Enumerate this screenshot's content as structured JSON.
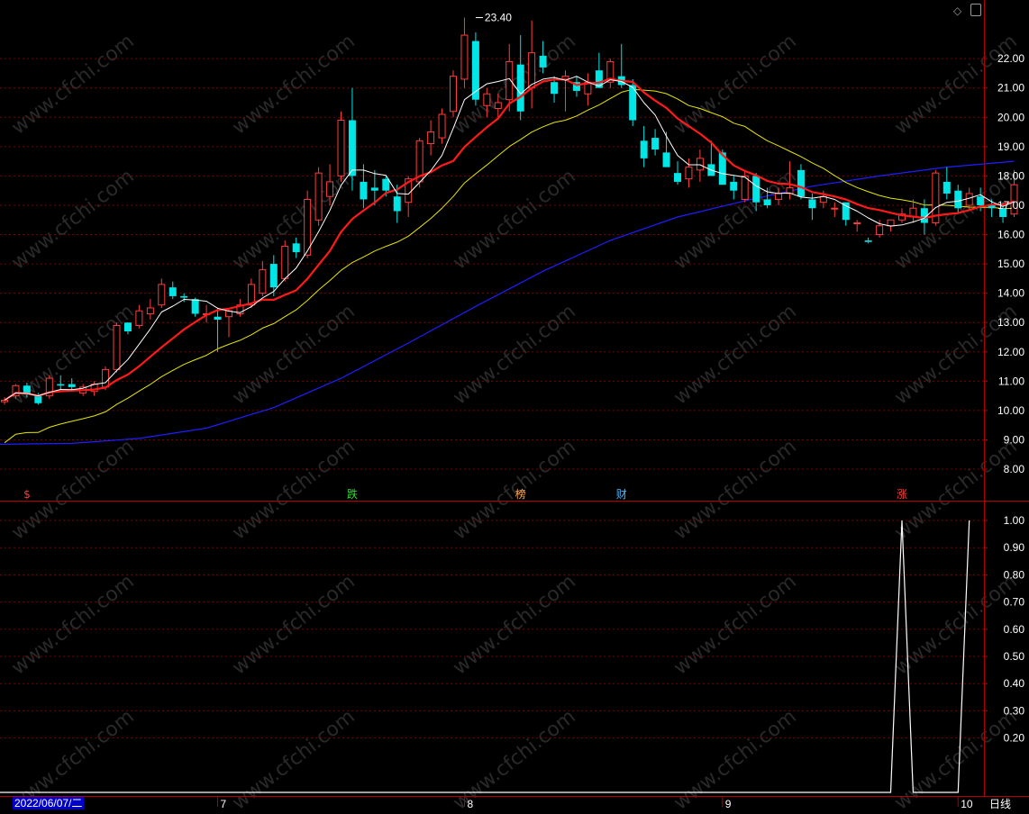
{
  "controls": {
    "diamond_icon": "diamond-icon",
    "window_icon": "window-icon"
  },
  "period_label": "日线",
  "date_cursor": "2022/06/07/二",
  "watermark": "www.cfchi.com",
  "colors": {
    "up": "#ff3c3c",
    "down": "#00e5e5",
    "ma5": "#ffffff",
    "ma10": "#ff1a1a",
    "ma20": "#e6e600",
    "ma60": "#1e1eff",
    "grid": "#7a0000",
    "border": "#b00000"
  },
  "chart_data": [
    {
      "type": "candlestick",
      "title": "",
      "y_ticks": [
        "8.00",
        "9.00",
        "10.00",
        "11.00",
        "12.00",
        "13.00",
        "14.00",
        "15.00",
        "16.00",
        "17.00",
        "18.00",
        "19.00",
        "20.00",
        "21.00",
        "22.00"
      ],
      "ylim": [
        7.05,
        24.0
      ],
      "x_labels": [
        {
          "index": 19,
          "label": "7"
        },
        {
          "index": 41,
          "label": "8"
        },
        {
          "index": 64,
          "label": "9"
        },
        {
          "index": 85,
          "label": "10"
        }
      ],
      "max_annotation": {
        "index": 42,
        "value": 23.4,
        "label": "23.40"
      },
      "event_markers": [
        {
          "index": 2,
          "label": "$",
          "color": "#ff3c3c"
        },
        {
          "index": 31,
          "label": "跌",
          "color": "#35d635"
        },
        {
          "index": 46,
          "label": "榜",
          "color": "#ffa84d"
        },
        {
          "index": 55,
          "label": "财",
          "color": "#4db8ff"
        },
        {
          "index": 80,
          "label": "涨",
          "color": "#ff3c3c"
        }
      ],
      "candles": [
        [
          10.3,
          10.45,
          10.2,
          10.35
        ],
        [
          10.5,
          10.9,
          10.4,
          10.85
        ],
        [
          10.85,
          10.95,
          10.45,
          10.55
        ],
        [
          10.5,
          10.6,
          10.2,
          10.25
        ],
        [
          10.5,
          11.2,
          10.4,
          11.1
        ],
        [
          10.9,
          11.2,
          10.7,
          10.85
        ],
        [
          10.9,
          11.1,
          10.7,
          10.8
        ],
        [
          10.6,
          10.9,
          10.5,
          10.8
        ],
        [
          10.65,
          11.0,
          10.5,
          10.9
        ],
        [
          10.8,
          11.5,
          10.7,
          11.4
        ],
        [
          11.4,
          13.0,
          11.3,
          12.9
        ],
        [
          13.0,
          13.0,
          12.6,
          12.7
        ],
        [
          12.9,
          13.6,
          12.8,
          13.4
        ],
        [
          13.3,
          13.8,
          13.1,
          13.5
        ],
        [
          13.6,
          14.5,
          13.5,
          14.3
        ],
        [
          14.2,
          14.4,
          13.8,
          13.9
        ],
        [
          13.9,
          14.0,
          13.7,
          13.85
        ],
        [
          13.8,
          13.85,
          13.2,
          13.3
        ],
        [
          13.3,
          13.6,
          13.0,
          13.3
        ],
        [
          13.2,
          13.5,
          12.0,
          13.1
        ],
        [
          13.2,
          13.5,
          12.5,
          13.4
        ],
        [
          13.3,
          13.8,
          13.2,
          13.6
        ],
        [
          13.6,
          14.5,
          13.5,
          14.3
        ],
        [
          14.0,
          15.1,
          13.9,
          14.8
        ],
        [
          15.0,
          15.3,
          13.9,
          14.2
        ],
        [
          14.5,
          15.8,
          14.4,
          15.6
        ],
        [
          15.7,
          15.9,
          15.2,
          15.4
        ],
        [
          15.3,
          17.5,
          15.2,
          17.2
        ],
        [
          16.5,
          18.3,
          16.3,
          18.1
        ],
        [
          17.3,
          18.4,
          17.0,
          17.8
        ],
        [
          18.0,
          20.2,
          17.8,
          19.9
        ],
        [
          19.9,
          21.0,
          17.5,
          18.0
        ],
        [
          17.8,
          18.4,
          16.9,
          17.2
        ],
        [
          17.6,
          18.2,
          17.0,
          17.5
        ],
        [
          17.9,
          18.0,
          17.3,
          17.5
        ],
        [
          17.3,
          17.7,
          16.4,
          16.8
        ],
        [
          17.1,
          18.0,
          16.6,
          17.9
        ],
        [
          17.8,
          19.3,
          17.6,
          19.2
        ],
        [
          19.1,
          19.9,
          18.7,
          19.5
        ],
        [
          19.3,
          20.3,
          19.1,
          20.1
        ],
        [
          20.2,
          21.6,
          20.0,
          21.4
        ],
        [
          21.3,
          23.4,
          21.0,
          22.8
        ],
        [
          22.6,
          22.9,
          20.4,
          20.6
        ],
        [
          20.4,
          21.0,
          20.0,
          20.8
        ],
        [
          20.3,
          20.8,
          20.0,
          20.5
        ],
        [
          20.6,
          22.5,
          20.2,
          21.9
        ],
        [
          21.8,
          22.8,
          19.9,
          20.2
        ],
        [
          21.0,
          23.3,
          20.3,
          22.2
        ],
        [
          22.1,
          22.6,
          21.5,
          21.7
        ],
        [
          21.2,
          21.4,
          20.5,
          20.8
        ],
        [
          21.3,
          21.6,
          20.2,
          21.4
        ],
        [
          21.2,
          21.4,
          20.7,
          20.9
        ],
        [
          20.8,
          21.5,
          20.4,
          21.2
        ],
        [
          21.6,
          22.2,
          21.3,
          21.0
        ],
        [
          21.2,
          22.0,
          21.0,
          21.9
        ],
        [
          21.4,
          22.5,
          21.0,
          21.1
        ],
        [
          21.1,
          21.3,
          19.7,
          19.9
        ],
        [
          19.2,
          19.7,
          18.3,
          18.6
        ],
        [
          19.3,
          19.6,
          18.7,
          18.9
        ],
        [
          18.8,
          19.5,
          18.6,
          18.3
        ],
        [
          18.1,
          18.5,
          17.7,
          17.8
        ],
        [
          17.9,
          18.6,
          17.6,
          18.3
        ],
        [
          18.2,
          18.9,
          17.8,
          18.6
        ],
        [
          18.4,
          19.2,
          18.1,
          18.0
        ],
        [
          18.8,
          18.9,
          17.7,
          17.7
        ],
        [
          17.8,
          18.0,
          17.2,
          17.5
        ],
        [
          17.2,
          18.2,
          17.1,
          18.0
        ],
        [
          18.0,
          18.1,
          16.8,
          17.1
        ],
        [
          17.2,
          17.6,
          16.9,
          17.0
        ],
        [
          17.2,
          17.6,
          17.0,
          17.4
        ],
        [
          17.4,
          18.5,
          17.2,
          17.6
        ],
        [
          18.2,
          18.4,
          17.2,
          17.3
        ],
        [
          17.2,
          17.4,
          16.5,
          16.9
        ],
        [
          17.1,
          17.5,
          16.9,
          17.3
        ],
        [
          16.9,
          17.1,
          16.6,
          16.9
        ],
        [
          17.1,
          17.1,
          16.3,
          16.5
        ],
        [
          16.4,
          16.5,
          16.1,
          16.4
        ],
        [
          15.8,
          15.9,
          15.7,
          15.75
        ],
        [
          16.0,
          16.5,
          15.9,
          16.3
        ],
        [
          16.3,
          16.5,
          16.1,
          16.5
        ],
        [
          16.5,
          16.9,
          16.4,
          16.7
        ],
        [
          16.6,
          17.2,
          16.4,
          16.9
        ],
        [
          16.9,
          17.2,
          16.0,
          16.4
        ],
        [
          16.4,
          18.2,
          16.3,
          18.1
        ],
        [
          17.8,
          18.3,
          17.2,
          17.4
        ],
        [
          17.5,
          17.7,
          16.7,
          16.9
        ],
        [
          17.0,
          17.6,
          16.8,
          17.4
        ],
        [
          17.3,
          17.6,
          16.8,
          17.0
        ],
        [
          17.0,
          17.2,
          16.6,
          16.9
        ],
        [
          16.9,
          17.1,
          16.4,
          16.6
        ],
        [
          16.7,
          18.2,
          16.6,
          17.7
        ]
      ],
      "ma60": [
        [
          0,
          8.85
        ],
        [
          6,
          8.88
        ],
        [
          12,
          9.05
        ],
        [
          18,
          9.4
        ],
        [
          24,
          10.1
        ],
        [
          30,
          11.1
        ],
        [
          36,
          12.3
        ],
        [
          42,
          13.55
        ],
        [
          48,
          14.75
        ],
        [
          54,
          15.8
        ],
        [
          60,
          16.6
        ],
        [
          66,
          17.15
        ],
        [
          72,
          17.65
        ],
        [
          78,
          18.0
        ],
        [
          84,
          18.3
        ],
        [
          90,
          18.5
        ]
      ]
    },
    {
      "type": "line",
      "title": "",
      "y_ticks": [
        "0.20",
        "0.30",
        "0.40",
        "0.50",
        "0.60",
        "0.70",
        "0.80",
        "0.90",
        "1.00"
      ],
      "ylim": [
        0.0,
        1.0
      ],
      "values": [
        {
          "index": 0,
          "value": 0.0
        },
        {
          "index": 79,
          "value": 0.0
        },
        {
          "index": 80,
          "value": 1.0
        },
        {
          "index": 81,
          "value": 0.0
        },
        {
          "index": 85,
          "value": 0.0
        },
        {
          "index": 86,
          "value": 1.0
        }
      ]
    }
  ]
}
